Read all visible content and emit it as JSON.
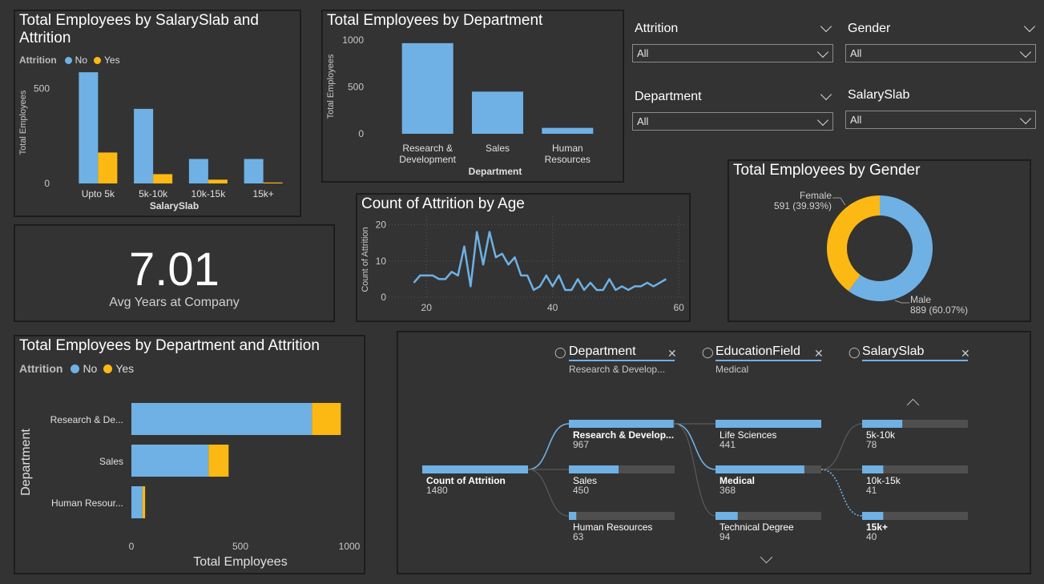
{
  "colors": {
    "no": "#6fb1e4",
    "yes": "#fdb913",
    "bg": "#333333",
    "track": "#555555",
    "grid": "#4a4a4a"
  },
  "salary_chart": {
    "title": "Total Employees by SalarySlab and Attrition",
    "legend_title": "Attrition",
    "legend": [
      "No",
      "Yes"
    ],
    "chart_data": {
      "type": "bar",
      "categories": [
        "Upto 5k",
        "5k-10k",
        "10k-15k",
        "15k+"
      ],
      "series": [
        {
          "name": "No",
          "values": [
            586,
            393,
            129,
            129
          ]
        },
        {
          "name": "Yes",
          "values": [
            163,
            49,
            20,
            5
          ]
        }
      ],
      "xlabel": "SalarySlab",
      "ylabel": "Total Employees",
      "yticks": [
        "0",
        "500"
      ],
      "ylim": [
        0,
        650
      ]
    }
  },
  "dept_chart": {
    "title": "Total Employees by Department",
    "chart_data": {
      "type": "bar",
      "categories": [
        "Research & Development",
        "Sales",
        "Human Resources"
      ],
      "category_lines": [
        [
          "Research &",
          "Development"
        ],
        [
          "Sales"
        ],
        [
          "Human",
          "Resources"
        ]
      ],
      "values": [
        967,
        450,
        63
      ],
      "xlabel": "Department",
      "ylabel": "Total Employees",
      "yticks": [
        "0",
        "500",
        "1000"
      ],
      "ylim": [
        0,
        1000
      ]
    }
  },
  "slicers": [
    {
      "title": "Attrition",
      "value": "All"
    },
    {
      "title": "Gender",
      "value": "All"
    },
    {
      "title": "Department",
      "value": "All"
    },
    {
      "title": "SalarySlab",
      "value": "All"
    }
  ],
  "kpi": {
    "value": "7.01",
    "label": "Avg Years at Company"
  },
  "age_chart": {
    "title": "Count of Attrition by Age",
    "chart_data": {
      "type": "line",
      "x": [
        18,
        19,
        20,
        21,
        22,
        23,
        24,
        25,
        26,
        27,
        28,
        29,
        30,
        31,
        32,
        33,
        34,
        35,
        36,
        37,
        38,
        39,
        40,
        41,
        42,
        43,
        44,
        45,
        46,
        47,
        48,
        49,
        50,
        51,
        52,
        53,
        54,
        55,
        56,
        57,
        58
      ],
      "y": [
        4,
        6,
        6,
        6,
        5,
        5,
        7,
        6,
        14,
        3,
        18,
        9,
        18,
        11,
        12,
        9,
        11,
        6,
        6,
        2,
        3,
        6,
        3,
        6,
        2,
        2,
        5,
        2,
        4,
        2,
        2,
        5,
        2,
        3,
        2,
        3,
        3,
        4,
        3,
        4,
        5
      ],
      "xticks": [
        "20",
        "40",
        "60"
      ],
      "yticks": [
        "0",
        "10",
        "20"
      ],
      "xlim": [
        14,
        61
      ],
      "ylim": [
        0,
        21
      ],
      "ylabel": "Count of Attrition"
    }
  },
  "gender_chart": {
    "title": "Total Employees by Gender",
    "chart_data": {
      "type": "pie",
      "slices": [
        {
          "label": "Male",
          "value": 889,
          "pct": "60.07%",
          "text": "889 (60.07%)"
        },
        {
          "label": "Female",
          "value": 591,
          "pct": "39.93%",
          "text": "591 (39.93%)"
        }
      ]
    }
  },
  "dept_attr_chart": {
    "title": "Total Employees by Department and Attrition",
    "legend_title": "Attrition",
    "legend": [
      "No",
      "Yes"
    ],
    "chart_data": {
      "type": "bar",
      "orientation": "horizontal",
      "stacked": true,
      "categories": [
        "Research & De...",
        "Sales",
        "Human Resour..."
      ],
      "series": [
        {
          "name": "No",
          "values": [
            828,
            354,
            51
          ]
        },
        {
          "name": "Yes",
          "values": [
            133,
            92,
            12
          ]
        }
      ],
      "xticks": [
        "0",
        "500",
        "1000"
      ],
      "xlim": [
        0,
        1000
      ],
      "xlabel": "Total Employees",
      "ylabel": "Department"
    }
  },
  "decomp_tree": {
    "levels": [
      {
        "name": "Department",
        "selected": "Research & Develop..."
      },
      {
        "name": "EducationField",
        "selected": "Medical"
      },
      {
        "name": "SalarySlab",
        "selected": ""
      }
    ],
    "root": {
      "name": "Count of Attrition",
      "value": "1480"
    },
    "col1": [
      {
        "name": "Research & Develop...",
        "value": "967",
        "frac": 0.99,
        "bold": true
      },
      {
        "name": "Sales",
        "value": "450",
        "frac": 0.47
      },
      {
        "name": "Human Resources",
        "value": "63",
        "frac": 0.07
      }
    ],
    "col2": [
      {
        "name": "Life Sciences",
        "value": "441",
        "frac": 1.0
      },
      {
        "name": "Medical",
        "value": "368",
        "frac": 0.84,
        "bold": true
      },
      {
        "name": "Technical Degree",
        "value": "94",
        "frac": 0.21
      }
    ],
    "col3": [
      {
        "name": "5k-10k",
        "value": "78",
        "frac": 0.38
      },
      {
        "name": "10k-15k",
        "value": "41",
        "frac": 0.2
      },
      {
        "name": "15k+",
        "value": "40",
        "frac": 0.2,
        "bold": true
      }
    ]
  }
}
